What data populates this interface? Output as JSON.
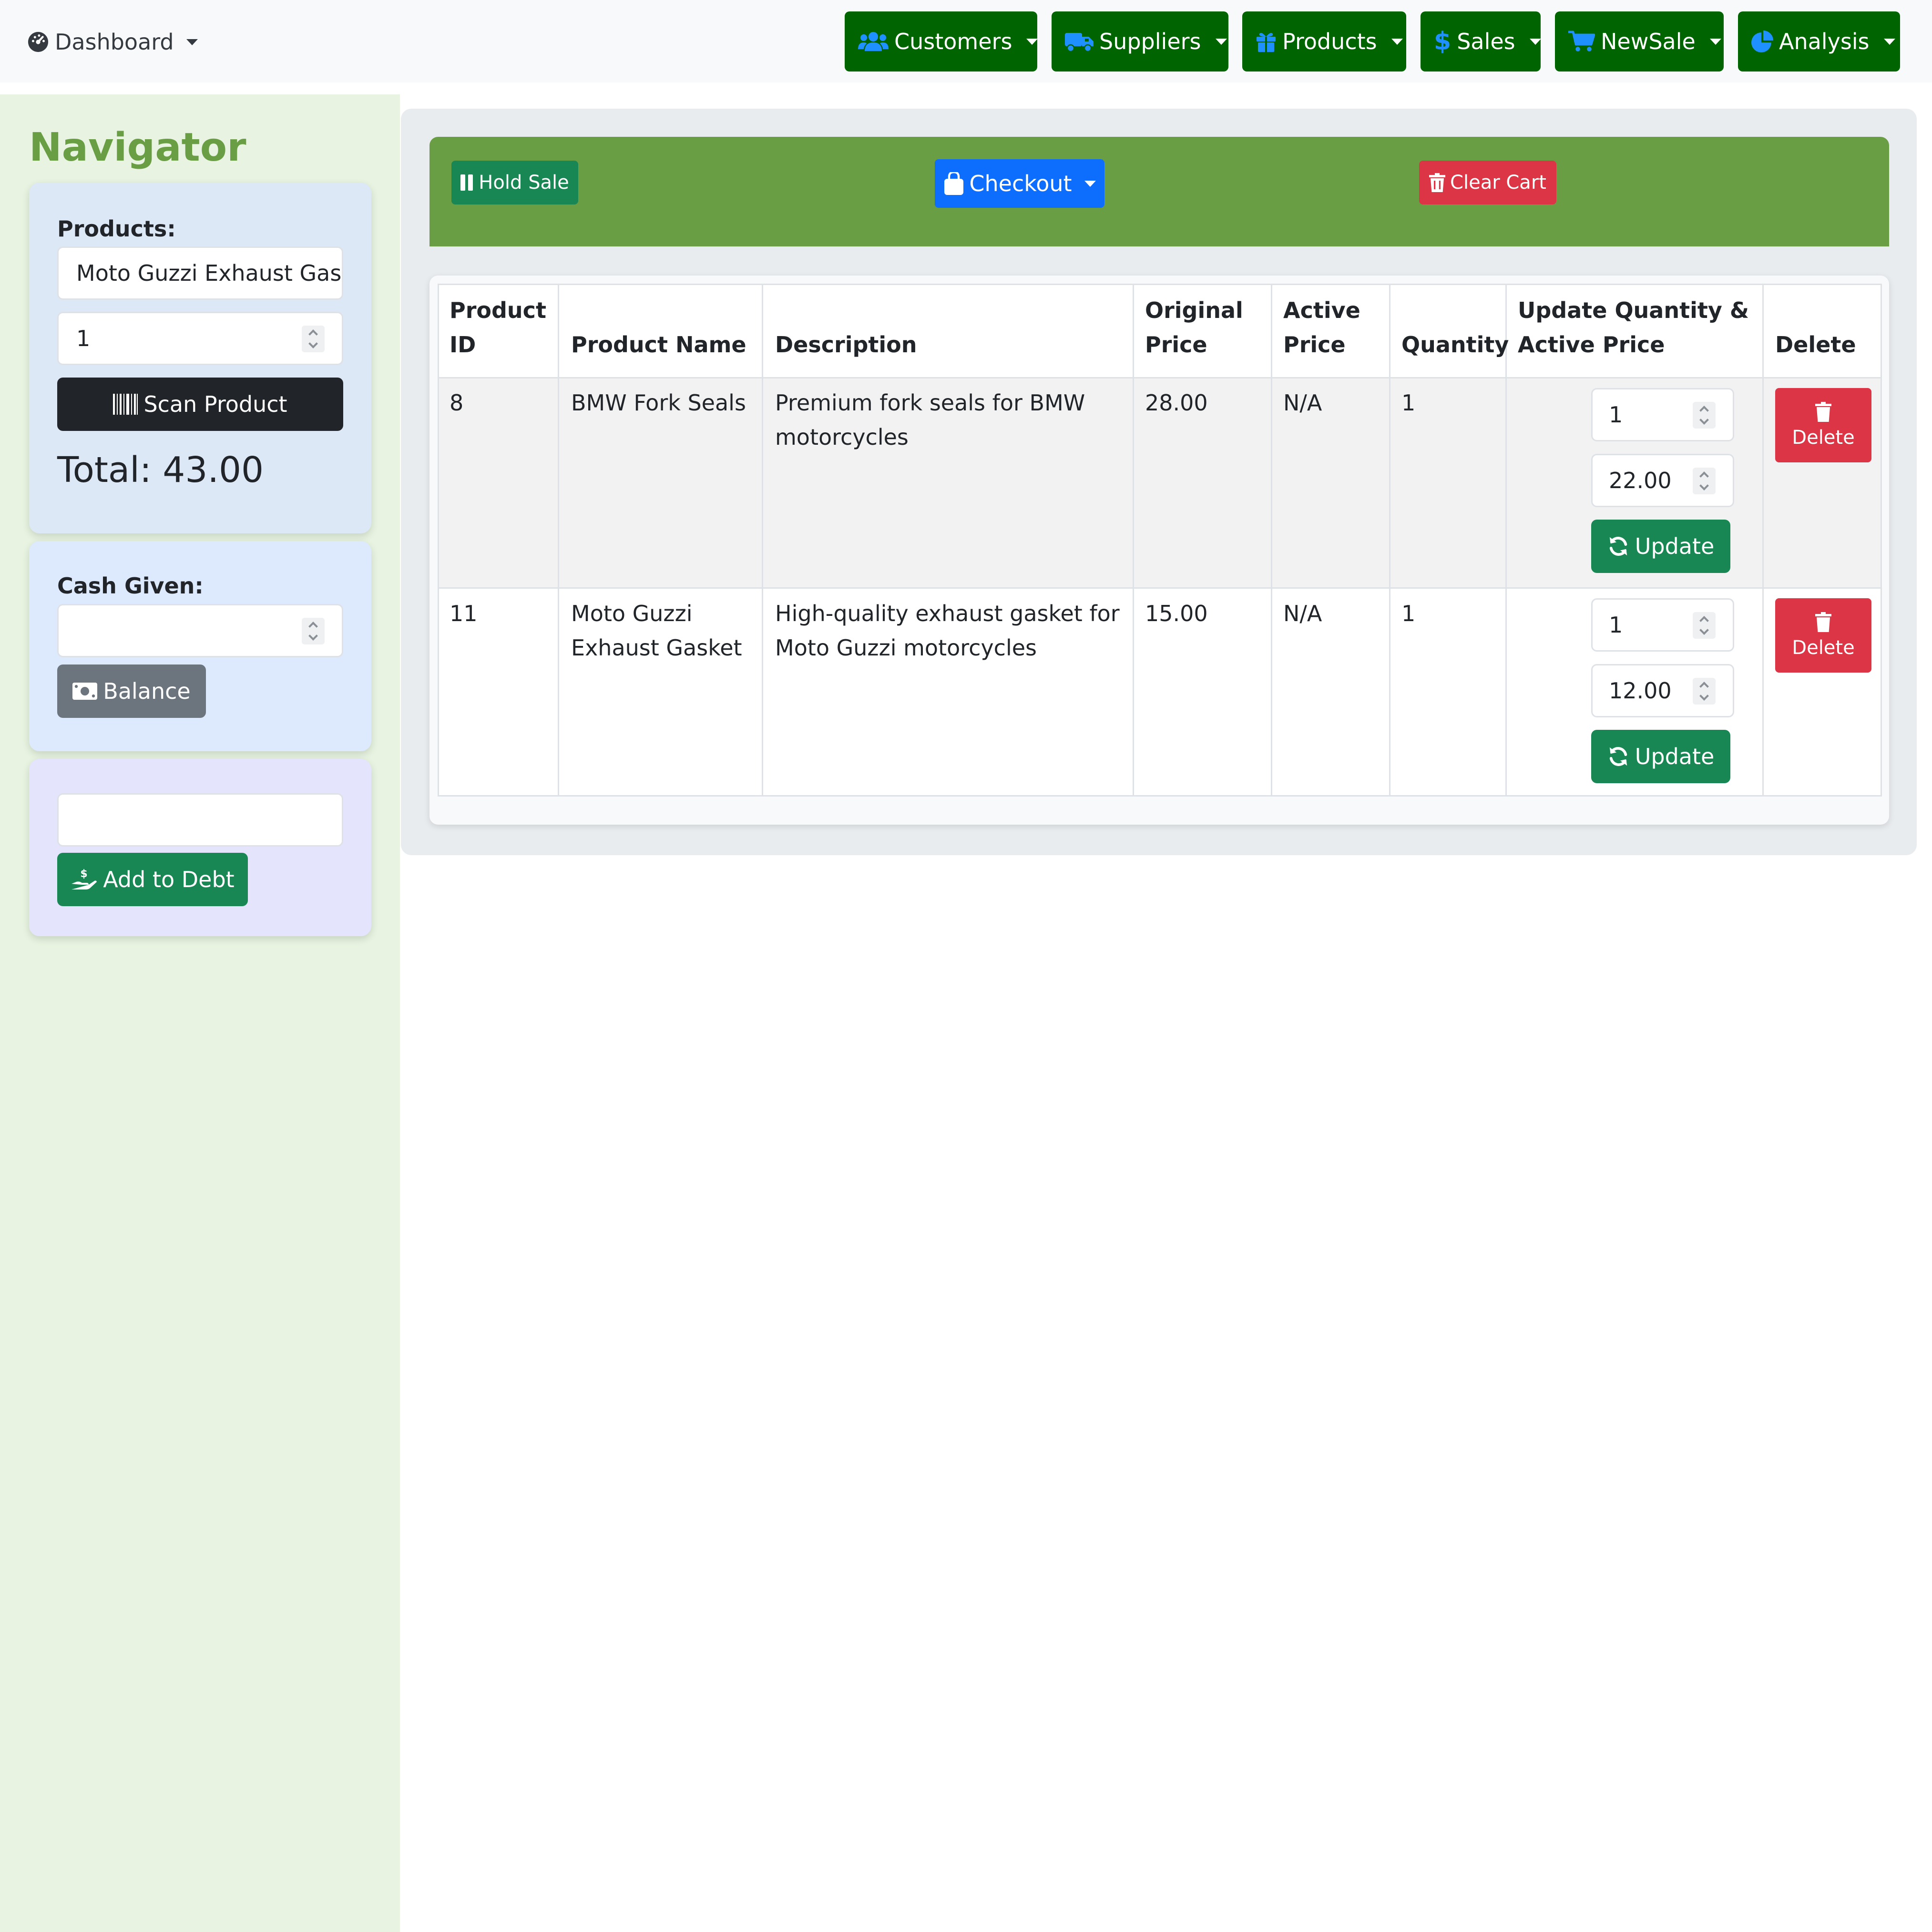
{
  "topbar": {
    "dashboard_label": "Dashboard",
    "menus": [
      {
        "label": "Customers",
        "icon": "users-icon"
      },
      {
        "label": "Suppliers",
        "icon": "truck-icon"
      },
      {
        "label": "Products",
        "icon": "gift-icon"
      },
      {
        "label": "Sales",
        "icon": "dollar-icon"
      },
      {
        "label": "NewSale",
        "icon": "cart-icon"
      },
      {
        "label": "Analysis",
        "icon": "pie-chart-icon"
      }
    ]
  },
  "sidebar": {
    "title": "Navigator",
    "products_label": "Products:",
    "product_value": "Moto Guzzi Exhaust Gasket",
    "quantity_value": "1",
    "scan_label": "Scan Product",
    "total_text": "Total: 43.00",
    "cash_label": "Cash Given:",
    "cash_value": "",
    "balance_label": "Balance",
    "debt_value": "",
    "debt_label": "Add to Debt"
  },
  "actions": {
    "hold_label": "Hold Sale",
    "checkout_label": "Checkout",
    "clear_label": "Clear Cart"
  },
  "table": {
    "headers": {
      "product_id": [
        "Product",
        "ID"
      ],
      "product_name": "Product Name",
      "description": "Description",
      "original_price": [
        "Original",
        "Price"
      ],
      "active_price": [
        "Active",
        "Price"
      ],
      "quantity": "Quantity",
      "update": [
        "Update Quantity &",
        "Active Price"
      ],
      "delete": "Delete"
    },
    "rows": [
      {
        "id": "8",
        "name_lines": [
          "BMW Fork Seals"
        ],
        "desc_lines": [
          "Premium fork seals for BMW",
          "motorcycles"
        ],
        "original_price": "28.00",
        "active_price": "N/A",
        "quantity": "1",
        "qty_input": "1",
        "price_input": "22.00",
        "update_label": "Update",
        "delete_label": "Delete"
      },
      {
        "id": "11",
        "name_lines": [
          "Moto Guzzi",
          "Exhaust Gasket"
        ],
        "desc_lines": [
          "High-quality exhaust gasket for",
          "Moto Guzzi motorcycles"
        ],
        "original_price": "15.00",
        "active_price": "N/A",
        "quantity": "1",
        "qty_input": "1",
        "price_input": "12.00",
        "update_label": "Update",
        "delete_label": "Delete"
      }
    ]
  },
  "colors": {
    "nav_button": "#006400",
    "accent_green": "#6a9e44",
    "primary": "#0d6efd",
    "danger": "#dc3545",
    "success": "#198754",
    "icon_blue": "#1e90ff"
  }
}
